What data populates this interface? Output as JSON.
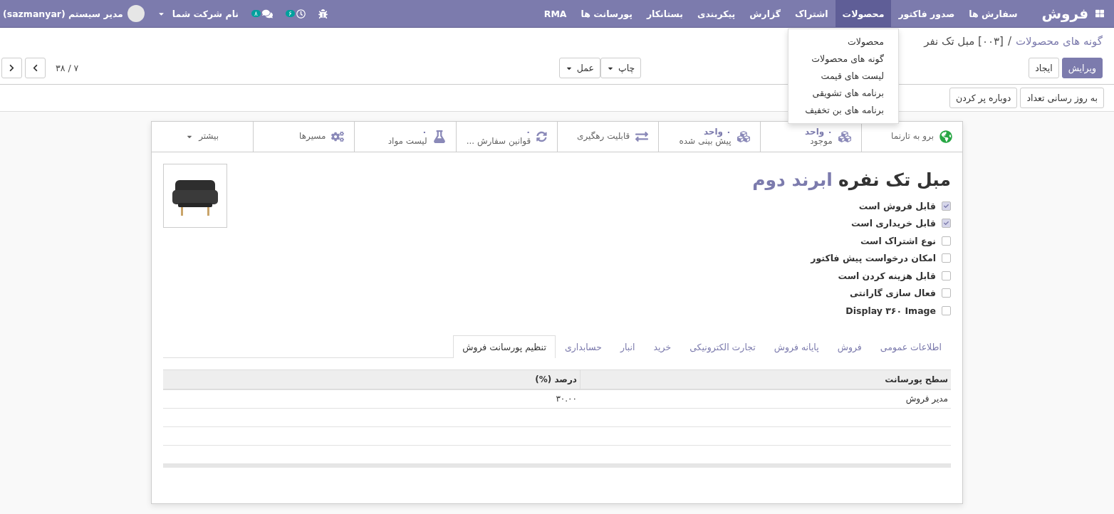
{
  "navbar": {
    "brand": "فروش",
    "menu": [
      {
        "label": "سفارش ها",
        "selected": false
      },
      {
        "label": "صدور فاکتور",
        "selected": false
      },
      {
        "label": "محصولات",
        "selected": true
      },
      {
        "label": "اشتراک",
        "selected": false
      },
      {
        "label": "گزارش",
        "selected": false
      },
      {
        "label": "پیکربندی",
        "selected": false
      },
      {
        "label": "بستانکار",
        "selected": false
      },
      {
        "label": "پورسانت ها",
        "selected": false
      },
      {
        "label": "RMA",
        "selected": false
      }
    ],
    "activity_count": "۶",
    "message_count": "۸",
    "company": "نام شرکت شما",
    "user": "مدیر سیستم (sazmanyar)"
  },
  "dropdown": [
    "محصولات",
    "گونه های محصولات",
    "لیست های قیمت",
    "برنامه های تشویقی",
    "برنامه های بن تخفیف"
  ],
  "breadcrumb": {
    "parent": "گونه های محصولات",
    "separator": "/",
    "current": "[۰۰۳] مبل تک نفر"
  },
  "buttons": {
    "edit": "ویرایش",
    "create": "ایجاد",
    "print": "چاپ",
    "action": "عمل"
  },
  "pager": "۷ / ۳۸",
  "header_buttons": [
    "به روز رسانی تعداد",
    "دوباره پر کردن"
  ],
  "smart_buttons": [
    {
      "label": "برو به تارنما"
    },
    {
      "value": "۰ واحد",
      "label": "موجود"
    },
    {
      "value": "۰ واحد",
      "label": "پیش بینی شده"
    },
    {
      "label": "قابلیت رهگیری"
    },
    {
      "value": "۰",
      "label": "قوانین سفارش ..."
    },
    {
      "value": "۰",
      "label": "لیست مواد"
    },
    {
      "label": "مسیرها"
    },
    {
      "label": "بیشتر"
    }
  ],
  "product": {
    "name": "مبل تک نفره",
    "variant": "ابرند دوم"
  },
  "options": [
    {
      "label": "قابل فروش است",
      "checked": true
    },
    {
      "label": "قابل خریداری است",
      "checked": true
    },
    {
      "label": "نوع اشتراک است",
      "checked": false
    },
    {
      "label": "امکان درخواست پیش فاکتور",
      "checked": false
    },
    {
      "label": "قابل هزینه کردن است",
      "checked": false
    },
    {
      "label": "فعال سازی گارانتی",
      "checked": false
    },
    {
      "label": "Display ۳۶۰ Image",
      "checked": false
    }
  ],
  "tabs": [
    {
      "label": "اطلاعات عمومی",
      "selected": false
    },
    {
      "label": "فروش",
      "selected": false
    },
    {
      "label": "پایانه فروش",
      "selected": false
    },
    {
      "label": "تجارت الکترونیکی",
      "selected": false
    },
    {
      "label": "خرید",
      "selected": false
    },
    {
      "label": "انبار",
      "selected": false
    },
    {
      "label": "حسابداری",
      "selected": false
    },
    {
      "label": "تنظیم پورسانت فروش",
      "selected": true
    }
  ],
  "table": {
    "columns": [
      "سطح پورسانت",
      "درصد (%)"
    ],
    "rows": [
      [
        "مدیر فروش",
        "۳۰.۰۰"
      ]
    ]
  }
}
